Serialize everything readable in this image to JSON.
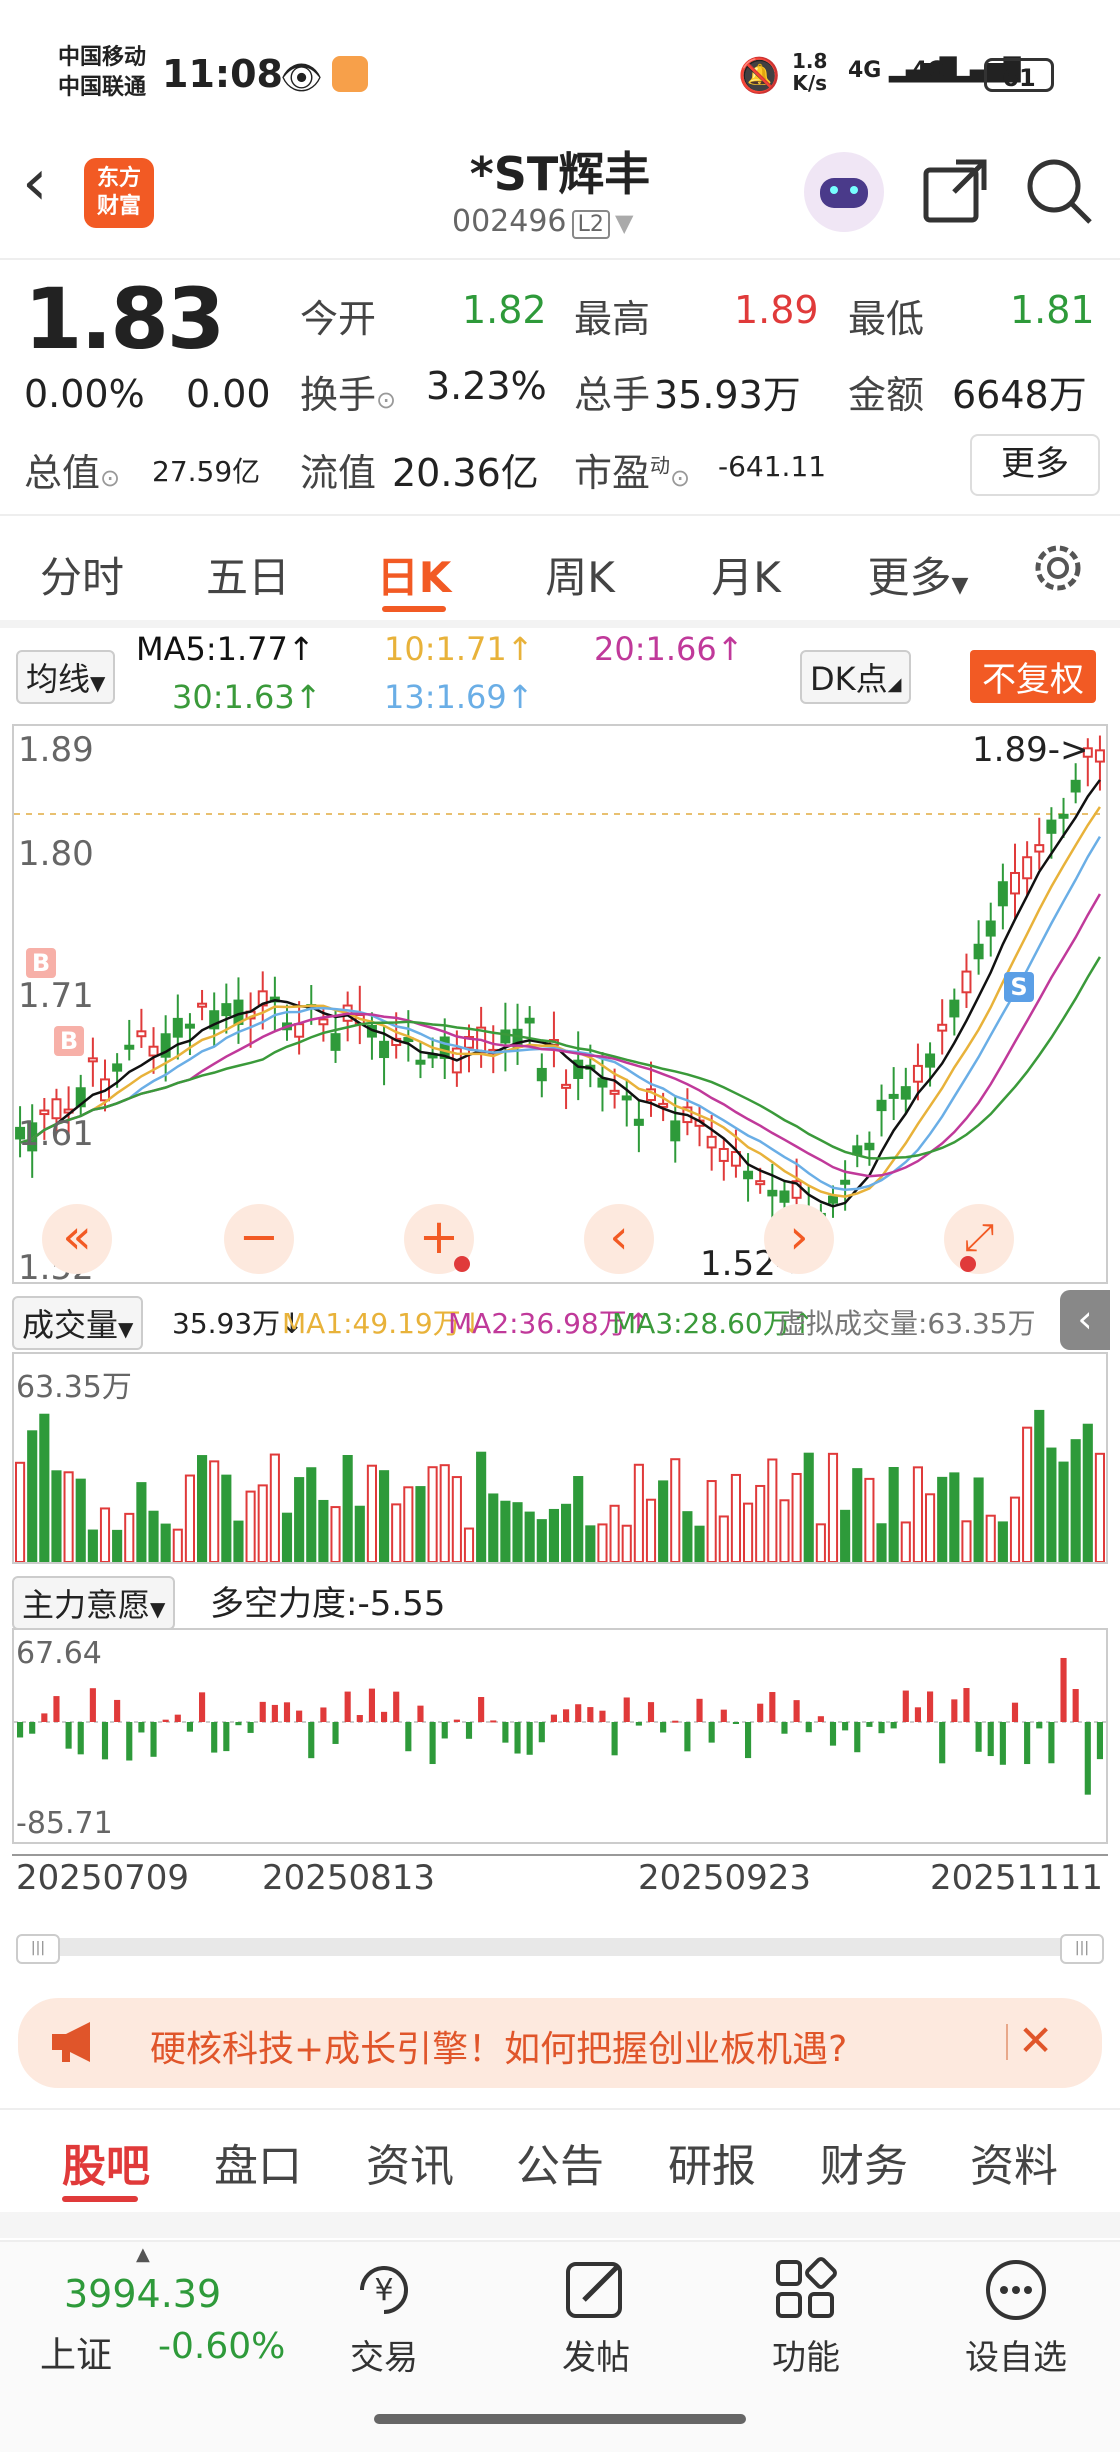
{
  "status_bar": {
    "carrier1": "中国移动",
    "carrier2": "中国联通",
    "time": "11:08",
    "speed_top": "1.8",
    "speed_unit": "K/s",
    "net1": "4G",
    "net2": "4G",
    "battery": "61"
  },
  "header": {
    "logo_line1": "东方",
    "logo_line2": "财富",
    "title": "*ST辉丰",
    "code": "002496",
    "level": "L2"
  },
  "quote": {
    "price": "1.83",
    "change_pct": "0.00%",
    "change": "0.00",
    "open_label": "今开",
    "open": "1.82",
    "high_label": "最高",
    "high": "1.89",
    "low_label": "最低",
    "low": "1.81",
    "turnover_label": "换手",
    "turnover": "3.23%",
    "volume_label": "总手",
    "volume": "35.93万",
    "amount_label": "金额",
    "amount": "6648万",
    "mktcap_label": "总值",
    "mktcap": "27.59亿",
    "float_label": "流值",
    "float": "20.36亿",
    "pe_label": "市盈",
    "pe_sup": "动",
    "pe": "-641.11",
    "more": "更多"
  },
  "ktabs": [
    "分时",
    "五日",
    "日K",
    "周K",
    "月K",
    "更多"
  ],
  "ktab_active": "日K",
  "ma_legend": {
    "label": "均线",
    "ma5": "MA5:1.77↑",
    "ma10": "10:1.71↑",
    "ma20": "20:1.66↑",
    "ma30": "30:1.63↑",
    "ma13": "13:1.69↑",
    "dk": "DK点",
    "fq": "不复权"
  },
  "colors": {
    "ma5": "#111111",
    "ma10": "#e8b23a",
    "ma20": "#c0399a",
    "ma30": "#3a9a3a",
    "ma13": "#6aaee6",
    "up": "#e03a3a",
    "down": "#2e9a3a",
    "accent": "#f25a24"
  },
  "price_axis": {
    "top": "1.89",
    "mid1": "1.80",
    "mid2": "1.71",
    "mid3": "1.61",
    "bottom": "1.52",
    "max_marker": "1.89->",
    "min_marker": "1.52->"
  },
  "markers": {
    "b": "B",
    "s": "S"
  },
  "volume_legend": {
    "label": "成交量",
    "vol": "35.93万↓",
    "ma1": "MA1:49.19万↓",
    "ma2": "MA2:36.98万↑",
    "ma3": "MA3:28.60万↑",
    "virtual": "虚拟成交量:63.35万",
    "axis_top": "63.35万"
  },
  "force_legend": {
    "label": "主力意愿",
    "value": "多空力度:-5.55",
    "axis_top": "67.64",
    "axis_bottom": "-85.71"
  },
  "dates": [
    "20250709",
    "20250813",
    "20250923",
    "20251111"
  ],
  "banner": {
    "text": "硬核科技+成长引擎！如何把握创业板机遇?"
  },
  "bottom_tabs": [
    "股吧",
    "盘口",
    "资讯",
    "公告",
    "研报",
    "财务",
    "资料"
  ],
  "bottom_tab_active": "股吧",
  "index": {
    "value": "3994.39",
    "name": "上证",
    "change": "-0.60%"
  },
  "nav": [
    {
      "label": "交易",
      "icon": "trade-icon"
    },
    {
      "label": "发帖",
      "icon": "post-icon"
    },
    {
      "label": "功能",
      "icon": "apps-icon"
    },
    {
      "label": "设自选",
      "icon": "more-dots-icon"
    }
  ]
}
